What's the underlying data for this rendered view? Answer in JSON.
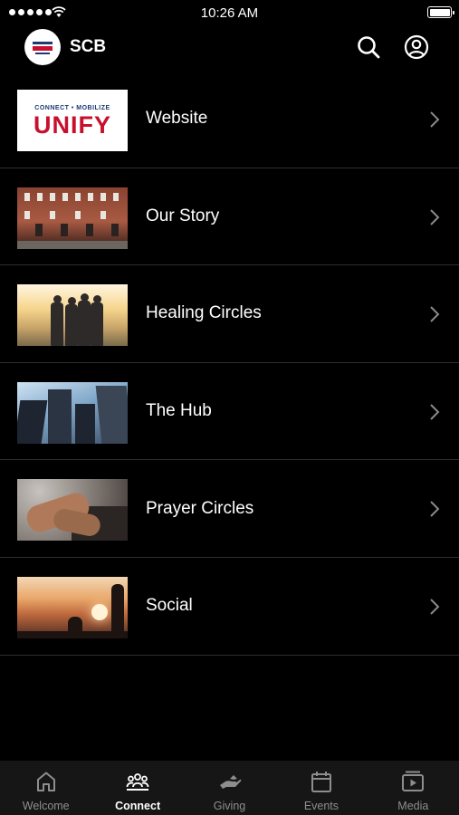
{
  "status": {
    "time": "10:26 AM"
  },
  "header": {
    "title": "SCB"
  },
  "items": [
    {
      "label": "Website",
      "thumb_sub": "CONNECT • MOBILIZE",
      "thumb_text": "UNIFY"
    },
    {
      "label": "Our Story"
    },
    {
      "label": "Healing Circles"
    },
    {
      "label": "The Hub"
    },
    {
      "label": "Prayer Circles"
    },
    {
      "label": "Social"
    }
  ],
  "tabs": [
    {
      "label": "Welcome",
      "icon": "home-icon"
    },
    {
      "label": "Connect",
      "icon": "group-icon",
      "active": true
    },
    {
      "label": "Giving",
      "icon": "giving-hand-icon"
    },
    {
      "label": "Events",
      "icon": "calendar-icon"
    },
    {
      "label": "Media",
      "icon": "media-play-icon"
    }
  ],
  "colors": {
    "background": "#000000",
    "tabbar": "#161616",
    "active_tab": "#ffffff",
    "inactive_tab": "#8e8e8e",
    "divider": "#2e2e2e"
  }
}
